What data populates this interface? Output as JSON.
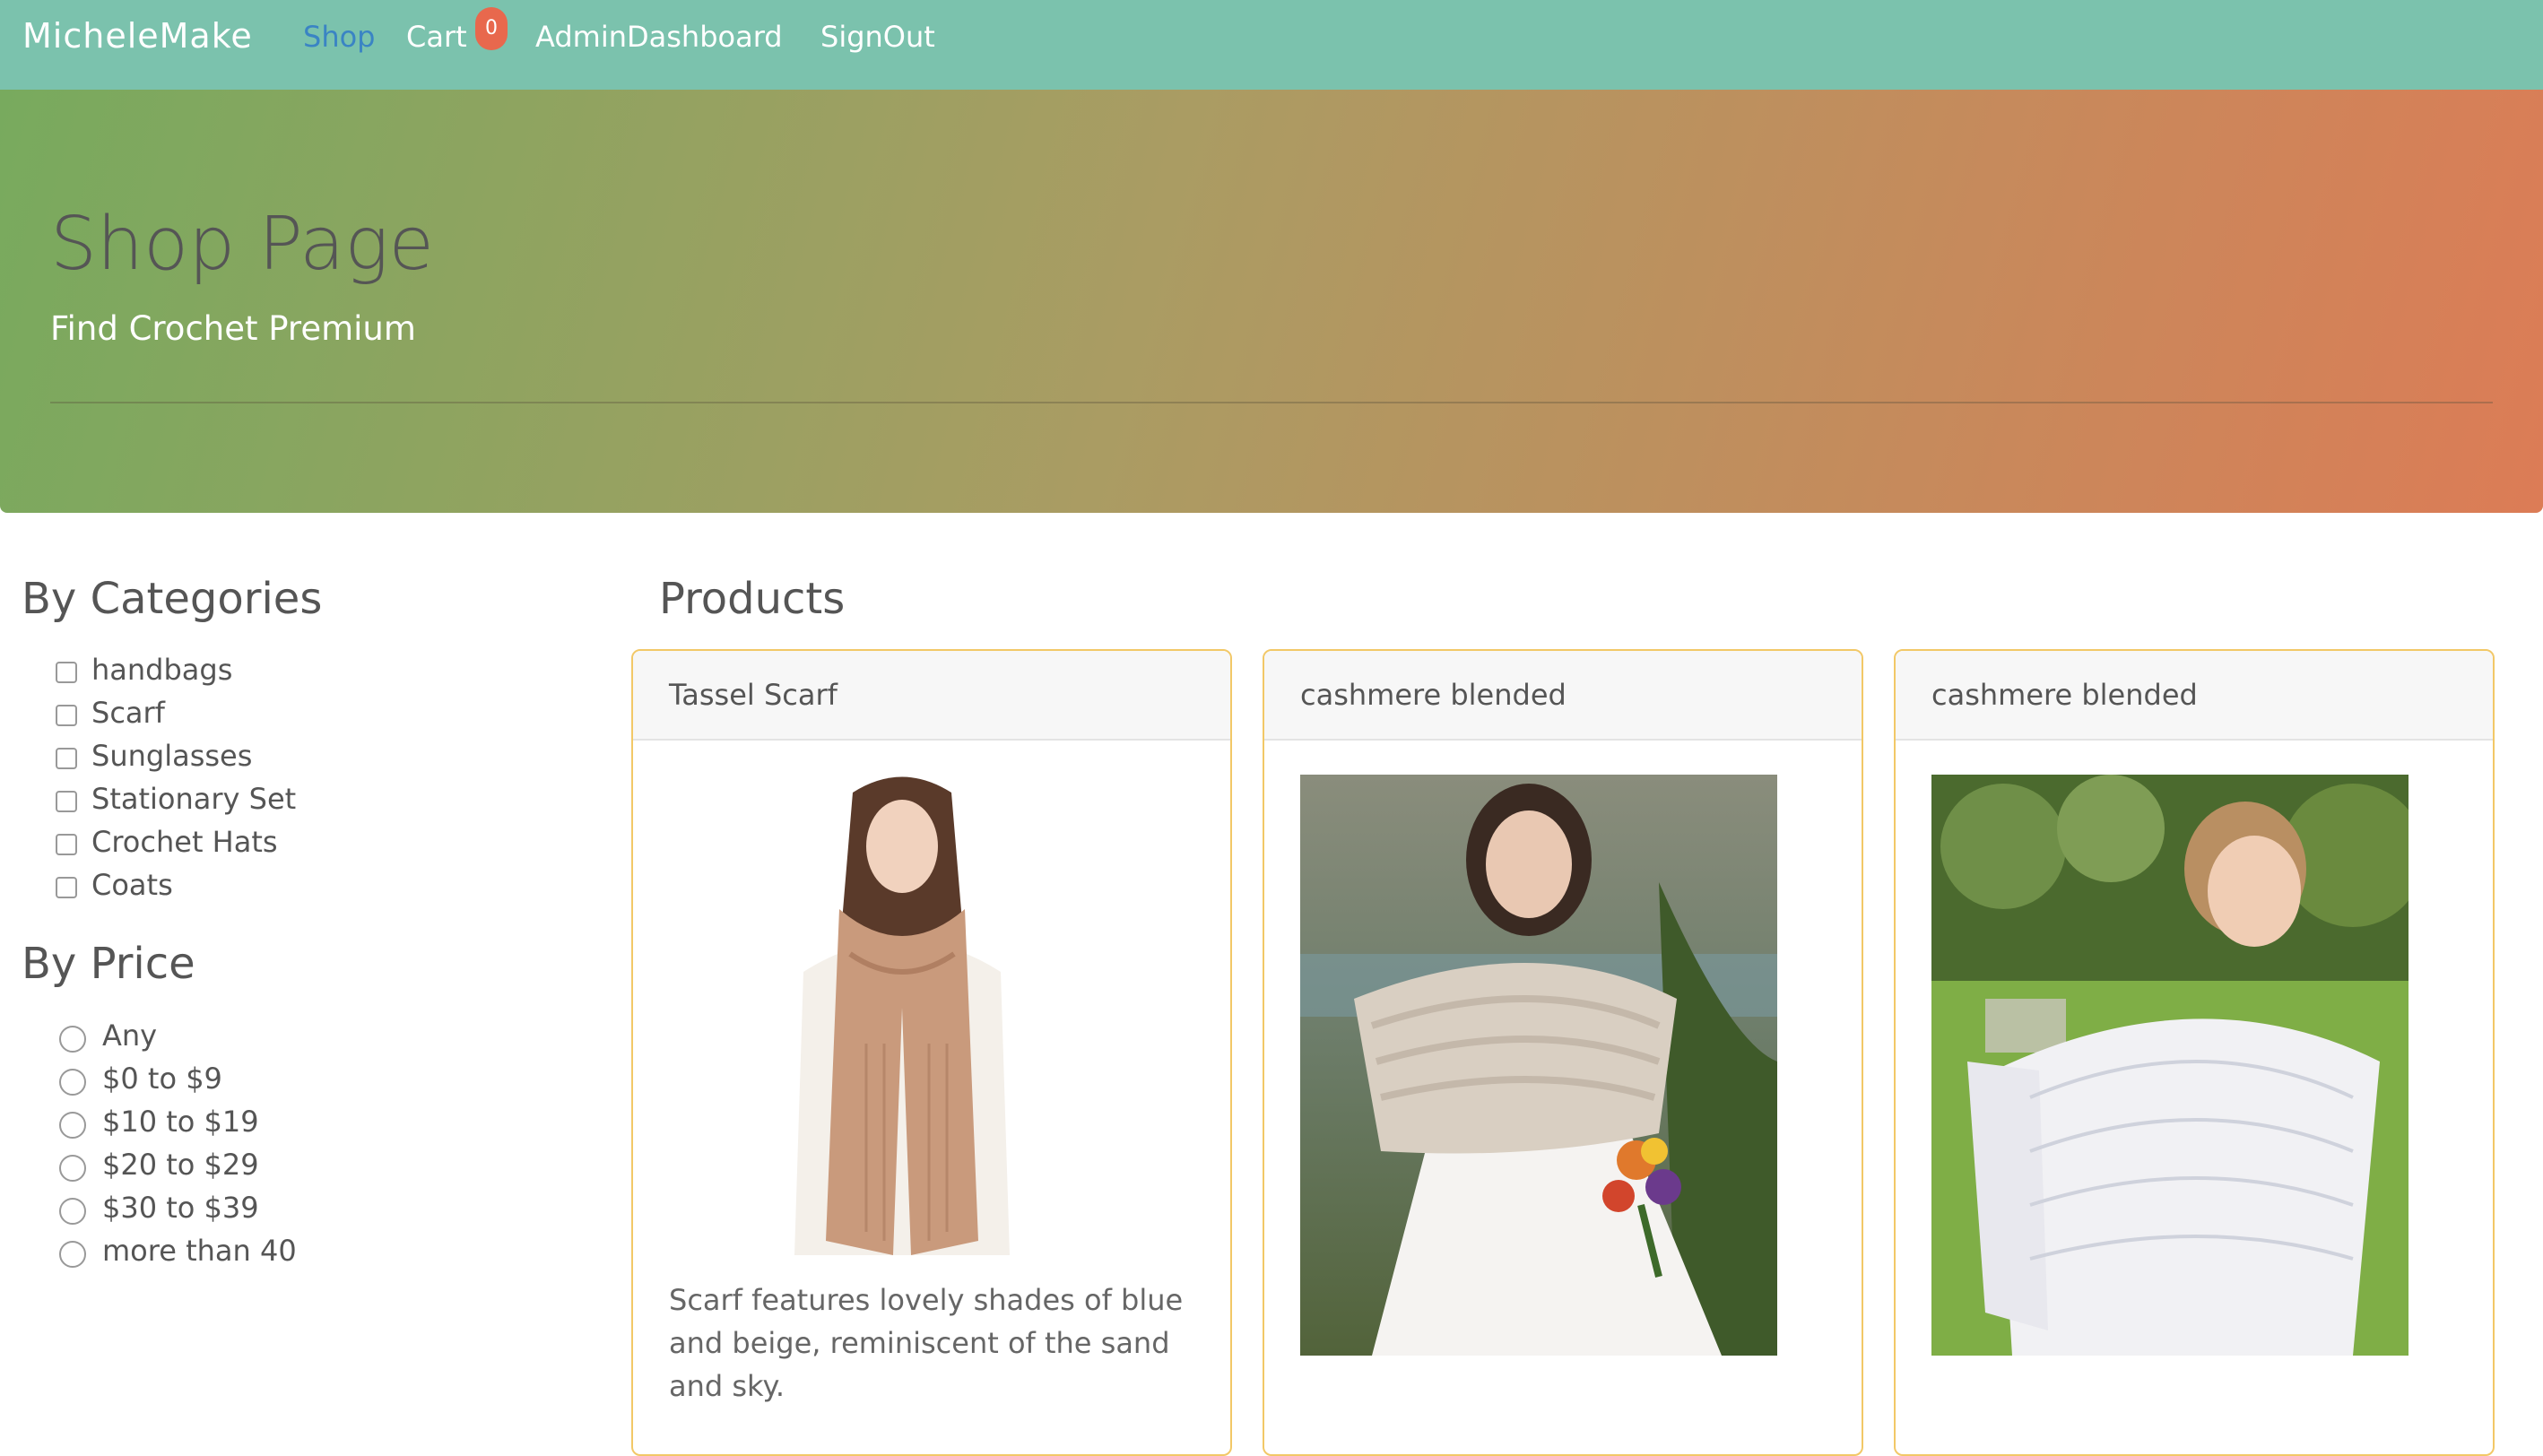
{
  "nav": {
    "brand": "MicheleMake",
    "links": [
      {
        "label": "Shop",
        "active": true
      },
      {
        "label": "Cart",
        "active": false
      },
      {
        "label": "AdminDashboard",
        "active": false
      },
      {
        "label": "SignOut",
        "active": false
      }
    ],
    "cart_count": "0"
  },
  "hero": {
    "title": "Shop Page",
    "subtitle": "Find Crochet Premium"
  },
  "sidebar": {
    "categories_heading": "By Categories",
    "categories": [
      "handbags",
      "Scarf",
      "Sunglasses",
      "Stationary Set",
      "Crochet Hats",
      "Coats"
    ],
    "price_heading": "By Price",
    "prices": [
      "Any",
      "$0 to $9",
      "$10 to $19",
      "$20 to $29",
      "$30 to $39",
      "more than 40"
    ]
  },
  "products": {
    "heading": "Products",
    "items": [
      {
        "name": "Tassel Scarf",
        "description": "Scarf features lovely shades of blue and beige, reminiscent of the sand and sky.",
        "image": "woman-in-camel-scarf-photo"
      },
      {
        "name": "cashmere blended",
        "description": "",
        "image": "bride-in-crochet-shawl-photo"
      },
      {
        "name": "cashmere blended",
        "description": "",
        "image": "woman-in-lace-shawl-photo"
      }
    ]
  },
  "colors": {
    "navbar": "#7bc2ad",
    "active_link": "#3a84c4",
    "badge": "#e8684d",
    "card_border": "#f2c867",
    "hero_gradient": [
      "#78aa5e",
      "#dc7c56"
    ]
  }
}
